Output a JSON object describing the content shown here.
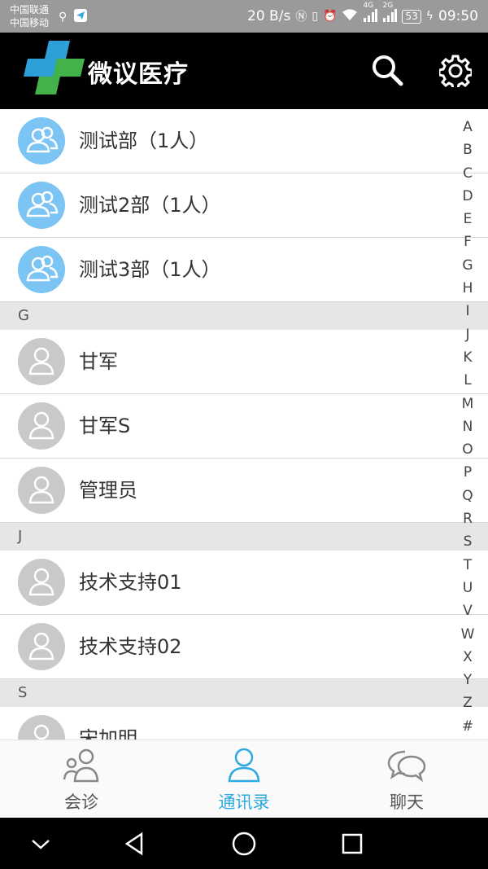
{
  "status_bar": {
    "carrier_1": "中国联通",
    "carrier_2": "中国移动",
    "net_speed": "20 B/s",
    "signal_1": "4G",
    "signal_2": "2G",
    "battery": "53",
    "time": "09:50"
  },
  "header": {
    "title": "微议医疗",
    "logo_colors": [
      "#2ea0d8",
      "#43b24a"
    ]
  },
  "list": {
    "departments": [
      {
        "label": "测试部（1人）"
      },
      {
        "label": "测试2部（1人）"
      },
      {
        "label": "测试3部（1人）"
      }
    ],
    "sections": [
      {
        "letter": "G",
        "items": [
          {
            "label": "甘军"
          },
          {
            "label": "甘军S"
          },
          {
            "label": "管理员"
          }
        ]
      },
      {
        "letter": "J",
        "items": [
          {
            "label": "技术支持01"
          },
          {
            "label": "技术支持02"
          }
        ]
      },
      {
        "letter": "S",
        "items": [
          {
            "label": "宋加明"
          }
        ]
      }
    ]
  },
  "alphabet_index": [
    "A",
    "B",
    "C",
    "D",
    "E",
    "F",
    "G",
    "H",
    "I",
    "J",
    "K",
    "L",
    "M",
    "N",
    "O",
    "P",
    "Q",
    "R",
    "S",
    "T",
    "U",
    "V",
    "W",
    "X",
    "Y",
    "Z",
    "#"
  ],
  "tabs": [
    {
      "label": "会诊",
      "icon": "people-icon",
      "active": false
    },
    {
      "label": "通讯录",
      "icon": "contact-icon",
      "active": true
    },
    {
      "label": "聊天",
      "icon": "chat-icon",
      "active": false
    }
  ],
  "colors": {
    "accent": "#2fa9e1",
    "dept_avatar": "#7cc4f4",
    "person_avatar": "#c9c9c9",
    "header_bg": "#000000"
  }
}
